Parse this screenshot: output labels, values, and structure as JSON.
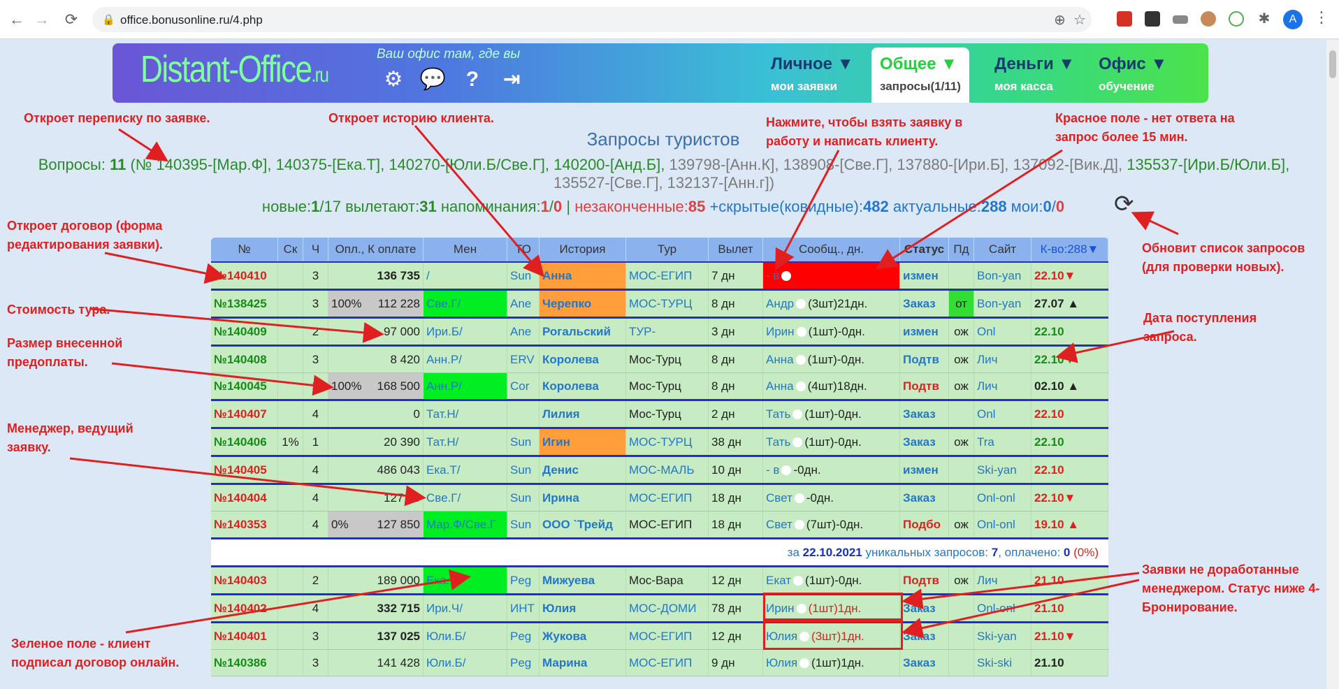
{
  "browser": {
    "url": "office.bonusonline.ru/4.php",
    "avatar_letter": "A"
  },
  "banner": {
    "logo_main": "Distant-Office",
    "logo_suffix": ".ru",
    "slogan": "Ваш офис там, где вы",
    "nav": [
      {
        "title": "Личное ▼",
        "sub": "мои заявки"
      },
      {
        "title": "Общее ▼",
        "sub": "запросы(1/11)"
      },
      {
        "title": "Деньги ▼",
        "sub": "моя касса"
      },
      {
        "title": "Офис ▼",
        "sub": "обучение"
      }
    ]
  },
  "page_title": "Запросы туристов",
  "questions": {
    "prefix": "Вопросы: ",
    "count": "11",
    "green_list": " (№ 140395-[Мар.Ф], 140375-[Ека.Т], 140270-[Юли.Б/Све.Г], 140200-[Анд.Б],",
    "gray_list1": " 139798-[Анн.К], 138908-[Све.Г], 137880-[Ири.Б], 137092-[Вик.Д],",
    "green_list2": " 135537-[Ири.Б/Юли.Б],",
    "gray_list2": " 135527-[Све.Г], 132137-[Анн.г])"
  },
  "stats": {
    "new_label": "новые:",
    "new_a": "1",
    "new_b": "/17",
    "fly_label": " вылетают:",
    "fly": "31",
    "rem_label": " напоминания:",
    "rem_a": "1",
    "rem_sep": "/",
    "rem_b": "0",
    "sep": " | ",
    "unf_label": "незаконченные:",
    "unf": "85",
    "hid_label": " +скрытые(ковидные):",
    "hid": "482",
    "act_label": " актуальные:",
    "act": "288",
    "my_label": " мои:",
    "my_a": "0",
    "my_sep": "/",
    "my_b": "0"
  },
  "table": {
    "headers": [
      "№",
      "Ск",
      "Ч",
      "Опл., К оплате",
      "Мен",
      "ТО",
      "История",
      "Тур",
      "Вылет",
      "Сообщ., дн.",
      "Статус",
      "Пд",
      "Сайт",
      "К-во:288▼"
    ],
    "rows": [
      {
        "num": "№140410",
        "num_color": "red",
        "sk": "",
        "ch": "3",
        "pct": "",
        "sum": "136 735",
        "sum_bold": true,
        "men": "/",
        "to": "Sun",
        "hist": "Анна",
        "hist_bg": "orange",
        "tour": "МОС-ЕГИП",
        "tour_blue": true,
        "fly": "7 дн",
        "msg": "- в",
        "msg_red": true,
        "status": "измен",
        "status_color": "blue",
        "pd": "",
        "site": "Bon-yan",
        "date": "22.10▼",
        "date_color": "red",
        "line": true
      },
      {
        "num": "№138425",
        "num_color": "green",
        "sk": "",
        "ch": "3",
        "pct": "100%",
        "sum": "112 228",
        "men": "Све.Г/",
        "men_bg": "lime",
        "to": "Ane",
        "hist": "Черепко",
        "hist_bg": "orange",
        "tour": "МОС-ТУРЦ",
        "tour_blue": true,
        "fly": "8 дн",
        "msg": "Андр",
        "msg_cnt": "(3шт)21дн.",
        "status": "Заказ",
        "status_color": "blue",
        "pd": "от",
        "site": "Bon-yan",
        "date": "27.07 ▲",
        "date_color": "dark",
        "line": true
      },
      {
        "num": "№140409",
        "num_color": "green",
        "sk": "",
        "ch": "2",
        "pct": "",
        "sum": "97 000",
        "men": "Ири.Б/",
        "to": "Ane",
        "hist": "Рогальский",
        "tour": "ТУР-",
        "tour_blue": true,
        "fly": "3 дн",
        "msg": "Ирин",
        "msg_cnt": "(1шт)-0дн.",
        "status": "измен",
        "status_color": "blue",
        "pd": "ож",
        "site": "Onl",
        "date": "22.10",
        "date_color": "green",
        "line": true
      },
      {
        "num": "№140408",
        "num_color": "green",
        "sk": "",
        "ch": "3",
        "pct": "",
        "sum": "8 420",
        "men": "Анн.Р/",
        "to": "ERV",
        "hist": "Королева",
        "tour": "Мос-Турц",
        "fly": "8 дн",
        "msg": "Анна",
        "msg_cnt": "(1шт)-0дн.",
        "status": "Подтв",
        "status_color": "blue",
        "pd": "ож",
        "site": "Лич",
        "date": "22.10▼",
        "date_color": "green",
        "line": false
      },
      {
        "num": "№140045",
        "num_color": "green",
        "sk": "",
        "ch": "3",
        "pct": "100%",
        "sum": "168 500",
        "men": "Анн.Р/",
        "men_bg": "lime",
        "to": "Cor",
        "hist": "Королева",
        "tour": "Мос-Турц",
        "fly": "8 дн",
        "msg": "Анна",
        "msg_cnt": "(4шт)18дн.",
        "status": "Подтв",
        "status_color": "red",
        "pd": "ож",
        "site": "Лич",
        "date": "02.10 ▲",
        "date_color": "dark",
        "line": true
      },
      {
        "num": "№140407",
        "num_color": "red",
        "sk": "",
        "ch": "4",
        "pct": "",
        "sum": "0",
        "men": "Тат.Н/",
        "to": "",
        "hist": "Лилия",
        "tour": "Мос-Турц",
        "fly": "2 дн",
        "msg": "Тать",
        "msg_cnt": "(1шт)-0дн.",
        "status": "Заказ",
        "status_color": "blue",
        "pd": "",
        "site": "Onl",
        "date": "22.10",
        "date_color": "red",
        "line": true
      },
      {
        "num": "№140406",
        "num_color": "green",
        "sk": "1%",
        "ch": "1",
        "pct": "",
        "sum": "20 390",
        "men": "Тат.Н/",
        "to": "Sun",
        "hist": "Игин",
        "hist_bg": "orange",
        "tour": "МОС-ТУРЦ",
        "tour_blue": true,
        "fly": "38 дн",
        "msg": "Тать",
        "msg_cnt": "(1шт)-0дн.",
        "status": "Заказ",
        "status_color": "blue",
        "pd": "ож",
        "site": "Tra",
        "date": "22.10",
        "date_color": "green",
        "line": true
      },
      {
        "num": "№140405",
        "num_color": "red",
        "sk": "",
        "ch": "4",
        "pct": "",
        "sum": "486 043",
        "men": "Ека.Т/",
        "to": "Sun",
        "hist": "Денис",
        "tour": "МОС-МАЛЬ",
        "tour_blue": true,
        "fly": "10 дн",
        "msg": "- в",
        "msg_cnt": "-0дн.",
        "status": "измен",
        "status_color": "blue",
        "pd": "",
        "site": "Ski-yan",
        "date": "22.10",
        "date_color": "red",
        "line": true
      },
      {
        "num": "№140404",
        "num_color": "red",
        "sk": "",
        "ch": "4",
        "pct": "",
        "sum": "127 95",
        "men": "Све.Г/",
        "to": "Sun",
        "hist": "Ирина",
        "tour": "МОС-ЕГИП",
        "tour_blue": true,
        "fly": "18 дн",
        "msg": "Свет",
        "msg_cnt": "-0дн.",
        "status": "Заказ",
        "status_color": "blue",
        "pd": "",
        "site": "Onl-onl",
        "date": "22.10▼",
        "date_color": "red",
        "line": false
      },
      {
        "num": "№140353",
        "num_color": "red",
        "sk": "",
        "ch": "4",
        "pct": "0%",
        "sum": "127 850",
        "men": "Мар.Ф/Све.Г",
        "men_bg": "lime",
        "to": "Sun",
        "hist": "ООО `Трейд",
        "tour": "МОС-ЕГИП",
        "fly": "18 дн",
        "msg": "Свет",
        "msg_cnt": "(7шт)-0дн.",
        "status": "Подбо",
        "status_color": "red",
        "pd": "ож",
        "site": "Onl-onl",
        "date": "19.10 ▲",
        "date_color": "red",
        "line": true
      }
    ],
    "summary": {
      "prefix": "за ",
      "date": "22.10.2021",
      "mid": " уникальных запросов: ",
      "uniq": "7",
      "paid_label": ", оплачено: ",
      "paid": "0",
      "pct": " (0%)"
    },
    "rows2": [
      {
        "num": "№140403",
        "num_color": "red",
        "sk": "",
        "ch": "2",
        "pct": "",
        "sum": "189 000",
        "men": "Ека.Т/",
        "men_bg": "lime",
        "to": "Peg",
        "hist": "Мижуева",
        "tour": "Мос-Вара",
        "fly": "12 дн",
        "msg": "Екат",
        "msg_cnt": "(1шт)-0дн.",
        "status": "Подтв",
        "status_color": "red",
        "pd": "ож",
        "site": "Лич",
        "date": "21.10",
        "date_color": "red",
        "line": true
      },
      {
        "num": "№140402",
        "num_color": "red",
        "sk": "",
        "ch": "4",
        "pct": "",
        "sum": "332 715",
        "sum_bold": true,
        "men": "Ири.Ч/",
        "to": "ИНТ",
        "hist": "Юлия",
        "tour": "МОС-ДОМИ",
        "tour_blue": true,
        "fly": "78 дн",
        "msg": "Ирин",
        "msg_cnt": "(1шт)1дн.",
        "msg_cnt_red": true,
        "status": "Заказ",
        "status_color": "blue",
        "pd": "",
        "site": "Onl-onl",
        "date": "21.10",
        "date_color": "red",
        "line": true
      },
      {
        "num": "№140401",
        "num_color": "red",
        "sk": "",
        "ch": "3",
        "pct": "",
        "sum": "137 025",
        "sum_bold": true,
        "men": "Юли.Б/",
        "to": "Peg",
        "hist": "Жукова",
        "tour": "МОС-ЕГИП",
        "tour_blue": true,
        "fly": "12 дн",
        "msg": "Юлия",
        "msg_cnt": "(3шт)1дн.",
        "msg_cnt_red": true,
        "status": "Заказ",
        "status_color": "blue",
        "pd": "",
        "site": "Ski-yan",
        "date": "21.10▼",
        "date_color": "red",
        "line": false
      },
      {
        "num": "№140386",
        "num_color": "green",
        "sk": "",
        "ch": "3",
        "pct": "",
        "sum": "141 428",
        "men": "Юли.Б/",
        "to": "Peg",
        "hist": "Марина",
        "tour": "МОС-ЕГИП",
        "tour_blue": true,
        "fly": "9 дн",
        "msg": "Юлия",
        "msg_cnt": "(1шт)1дн.",
        "status": "Заказ",
        "status_color": "blue",
        "pd": "",
        "site": "Ski-ski",
        "date": "21.10",
        "date_color": "dark",
        "line": false
      }
    ]
  },
  "annotations": {
    "a1": "Откроет переписку по заявке.",
    "a2": "Откроет историю клиента.",
    "a3": "Нажмите, чтобы взять заявку в работу и написать клиенту.",
    "a4": "Красное поле - нет ответа на запрос более 15 мин.",
    "a5": "Откроет договор (форма редактирования заявки).",
    "a6": "Обновит список запросов (для проверки новых).",
    "a7": "Стоимость тура.",
    "a8": "Дата поступления запроса.",
    "a9": "Размер внесенной предоплаты.",
    "a10": "Менеджер, ведущий заявку.",
    "a11": "Заявки не доработанные менеджером. Статус ниже 4-Бронирование.",
    "a12": "Зеленое поле - клиент подписал договор онлайн."
  }
}
